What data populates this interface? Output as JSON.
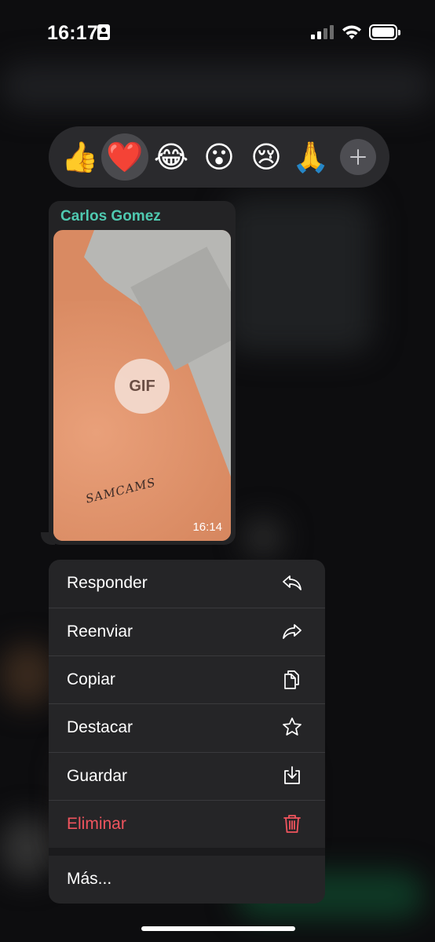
{
  "status_bar": {
    "time": "16:17"
  },
  "reactions": [
    {
      "emoji": "👍",
      "name": "thumbs-up",
      "selected": false
    },
    {
      "emoji": "❤️",
      "name": "red-heart",
      "selected": true
    },
    {
      "emoji": "😂",
      "name": "tears-of-joy",
      "selected": false
    },
    {
      "emoji": "😮",
      "name": "surprised",
      "selected": false
    },
    {
      "emoji": "😢",
      "name": "crying",
      "selected": false
    },
    {
      "emoji": "🙏",
      "name": "folded-hands",
      "selected": false
    }
  ],
  "message": {
    "sender": "Carlos Gomez",
    "media_badge": "GIF",
    "tattoo_text": "SAMCAMS",
    "time": "16:14"
  },
  "menu": {
    "items": [
      {
        "label": "Responder",
        "icon": "reply-icon"
      },
      {
        "label": "Reenviar",
        "icon": "forward-icon"
      },
      {
        "label": "Copiar",
        "icon": "copy-icon"
      },
      {
        "label": "Destacar",
        "icon": "star-icon"
      },
      {
        "label": "Guardar",
        "icon": "save-icon"
      },
      {
        "label": "Eliminar",
        "icon": "trash-icon"
      }
    ],
    "more_label": "Más..."
  },
  "colors": {
    "sender_name": "#4fc9b0",
    "danger": "#f0545e",
    "menu_bg": "#252527"
  }
}
